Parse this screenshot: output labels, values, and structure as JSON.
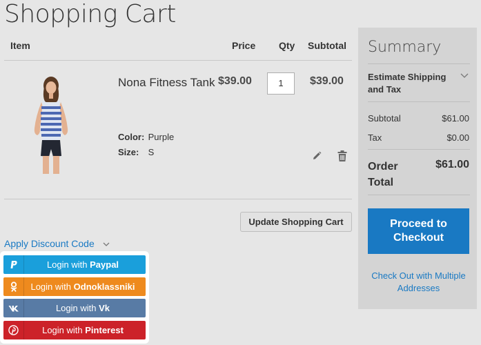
{
  "page": {
    "title": "Shopping Cart"
  },
  "cart": {
    "headers": {
      "item": "Item",
      "price": "Price",
      "qty": "Qty",
      "subtotal": "Subtotal"
    },
    "items": [
      {
        "name": "Nona Fitness Tank",
        "price": "$39.00",
        "qty": "1",
        "subtotal": "$39.00",
        "options": [
          {
            "label": "Color:",
            "value": "Purple"
          },
          {
            "label": "Size:",
            "value": "S"
          }
        ]
      }
    ],
    "update_label": "Update Shopping Cart",
    "discount_label": "Apply Discount Code"
  },
  "social": {
    "prefix": "Login with",
    "buttons": [
      {
        "provider": "Paypal",
        "icon": "paypal-icon",
        "color": "#1a9fdb"
      },
      {
        "provider": "Odnoklassniki",
        "icon": "odnoklassniki-icon",
        "color": "#ee8a1e"
      },
      {
        "provider": "Vk",
        "icon": "vk-icon",
        "color": "#587ba5"
      },
      {
        "provider": "Pinterest",
        "icon": "pinterest-icon",
        "color": "#cc2229"
      }
    ]
  },
  "summary": {
    "title": "Summary",
    "estimate_label": "Estimate Shipping and Tax",
    "subtotal_label": "Subtotal",
    "subtotal_value": "$61.00",
    "tax_label": "Tax",
    "tax_value": "$0.00",
    "order_total_label": "Order Total",
    "order_total_value": "$61.00",
    "checkout_label": "Proceed to Checkout",
    "multi_label": "Check Out with Multiple Addresses"
  },
  "colors": {
    "accent": "#1979c3",
    "page_bg": "#e6e6e6",
    "summary_bg": "#d4d4d4"
  }
}
